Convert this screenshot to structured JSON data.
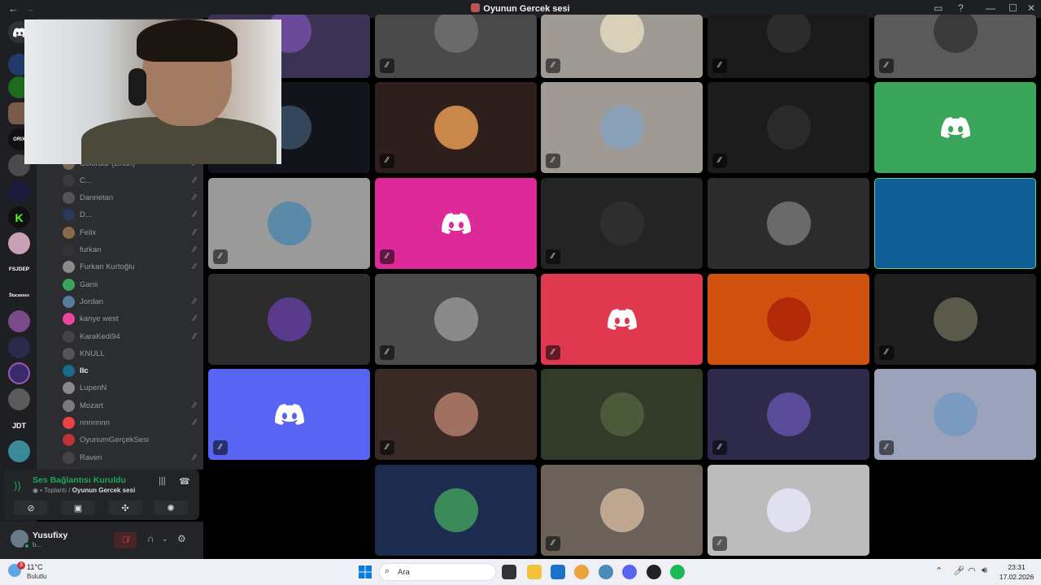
{
  "window": {
    "title": "Oyunun Gercek sesi"
  },
  "servers": [
    "discord-home",
    "server-1",
    "server-2",
    "server-3",
    "ORIX",
    "server-5",
    "server-6",
    "K",
    "server-8",
    "FSJDEP",
    "stucasses",
    "server-11",
    "server-12",
    "server-13",
    "server-14",
    "JDT",
    "server-16"
  ],
  "server_labels": {
    "orix": "ORIX",
    "fsjdep": "FSJDEP",
    "jdt": "JDT",
    "stu": "Ŝtucasses"
  },
  "members": [
    {
      "name": "Colorbar (Ertan)",
      "muted": true,
      "active": false,
      "color": "#7a6a55"
    },
    {
      "name": "C...",
      "muted": true,
      "active": false,
      "color": "#3a3a3a"
    },
    {
      "name": "Dannetan",
      "muted": true,
      "active": false,
      "color": "#555"
    },
    {
      "name": "D...",
      "muted": true,
      "active": false,
      "color": "#2a3a5a"
    },
    {
      "name": "Felix",
      "muted": true,
      "active": false,
      "color": "#8a6a4a"
    },
    {
      "name": "furkan",
      "muted": true,
      "active": false,
      "color": "#333"
    },
    {
      "name": "Furkan Kurtoğlu",
      "muted": true,
      "active": false,
      "color": "#8a8a8a"
    },
    {
      "name": "Ganii",
      "muted": false,
      "active": false,
      "color": "#3ba55c"
    },
    {
      "name": "Jordan",
      "muted": true,
      "active": false,
      "color": "#5a7a9a"
    },
    {
      "name": "kanye west",
      "muted": true,
      "active": false,
      "color": "#eb459e"
    },
    {
      "name": "KaraKedi94",
      "muted": true,
      "active": false,
      "color": "#444"
    },
    {
      "name": "KNULL",
      "muted": false,
      "active": false,
      "color": "#555"
    },
    {
      "name": "llc",
      "muted": false,
      "active": true,
      "color": "#1a6a8a"
    },
    {
      "name": "LupenN",
      "muted": false,
      "active": false,
      "color": "#8a8a8a"
    },
    {
      "name": "Mozart",
      "muted": true,
      "active": false,
      "color": "#7a7a7a"
    },
    {
      "name": "nnnnnnn",
      "muted": true,
      "active": false,
      "color": "#ed4245"
    },
    {
      "name": "OyunumGerçekSesi",
      "muted": false,
      "active": false,
      "color": "#b33"
    },
    {
      "name": "Raven",
      "muted": true,
      "active": false,
      "color": "#444"
    }
  ],
  "voice": {
    "status": "Ses Bağlantısı Kuruldu",
    "server": "Toplantı",
    "channel": "Oyunun Gercek sesi"
  },
  "user": {
    "name": "Yusufixy",
    "status": "b..."
  },
  "tiles": [
    {
      "bg": "#3c3254",
      "avatar": "#6b4a9a",
      "logo": false,
      "muted": false
    },
    {
      "bg": "#4a4a4a",
      "avatar": "#6a6a6a",
      "logo": false,
      "muted": true
    },
    {
      "bg": "#a09a95",
      "avatar": "#d8d0b8",
      "logo": false,
      "muted": true
    },
    {
      "bg": "#1a1a1a",
      "avatar": "#2c2c2c",
      "logo": false,
      "muted": true
    },
    {
      "bg": "#5a5a5a",
      "avatar": "#3a3a3a",
      "logo": false,
      "muted": true
    },
    {
      "bg": "#12141c",
      "avatar": "#34465a",
      "logo": false,
      "muted": false
    },
    {
      "bg": "#2e1f1c",
      "avatar": "#c9874a",
      "logo": false,
      "muted": true
    },
    {
      "bg": "#a09a95",
      "avatar": "#8aa0b8",
      "logo": false,
      "muted": true
    },
    {
      "bg": "#1c1c1c",
      "avatar": "#2a2a2a",
      "logo": false,
      "muted": true
    },
    {
      "bg": "#3ba55c",
      "avatar": "",
      "logo": true,
      "muted": false
    },
    {
      "bg": "#9a9a9a",
      "avatar": "#5a8aa8",
      "logo": false,
      "muted": true
    },
    {
      "bg": "#dd2a98",
      "avatar": "",
      "logo": true,
      "muted": true
    },
    {
      "bg": "#242424",
      "avatar": "#2e2e2e",
      "logo": false,
      "muted": true
    },
    {
      "bg": "#2c2c2c",
      "avatar": "#6a6a6a",
      "logo": false,
      "muted": false
    },
    {
      "bg": "#0f5e96",
      "avatar": "",
      "logo": false,
      "muted": false
    },
    {
      "bg": "#2c2c2c",
      "avatar": "#5a3a8a",
      "logo": false,
      "muted": false
    },
    {
      "bg": "#4a4a4a",
      "avatar": "#8a8a8a",
      "logo": false,
      "muted": true
    },
    {
      "bg": "#e0384e",
      "avatar": "",
      "logo": true,
      "muted": true
    },
    {
      "bg": "#d1520f",
      "avatar": "#b32a0a",
      "logo": false,
      "muted": false
    },
    {
      "bg": "#1e1e1e",
      "avatar": "#5a5a4a",
      "logo": false,
      "muted": true
    },
    {
      "bg": "#5865f2",
      "avatar": "",
      "logo": true,
      "muted": true
    },
    {
      "bg": "#3a2a26",
      "avatar": "#a07060",
      "logo": false,
      "muted": true
    },
    {
      "bg": "#323b2a",
      "avatar": "#4a5a3a",
      "logo": false,
      "muted": false
    },
    {
      "bg": "#2e2a4a",
      "avatar": "#5a4a9a",
      "logo": false,
      "muted": true
    },
    {
      "bg": "#9ba3bb",
      "avatar": "#7a9ac0",
      "logo": false,
      "muted": true
    },
    {
      "bg": "#1d2c4e",
      "avatar": "#3a8a5a",
      "logo": false,
      "muted": false
    },
    {
      "bg": "#6a6258",
      "avatar": "#c0a890",
      "logo": false,
      "muted": true
    },
    {
      "bg": "#bcbcbc",
      "avatar": "#e0e0f0",
      "logo": false,
      "muted": true
    }
  ],
  "taskbar": {
    "temperature": "11°C",
    "weather": "Bulutlu",
    "weather_badge": "3",
    "search_placeholder": "Ara",
    "time": "23:31",
    "date": "17.02.2026"
  }
}
